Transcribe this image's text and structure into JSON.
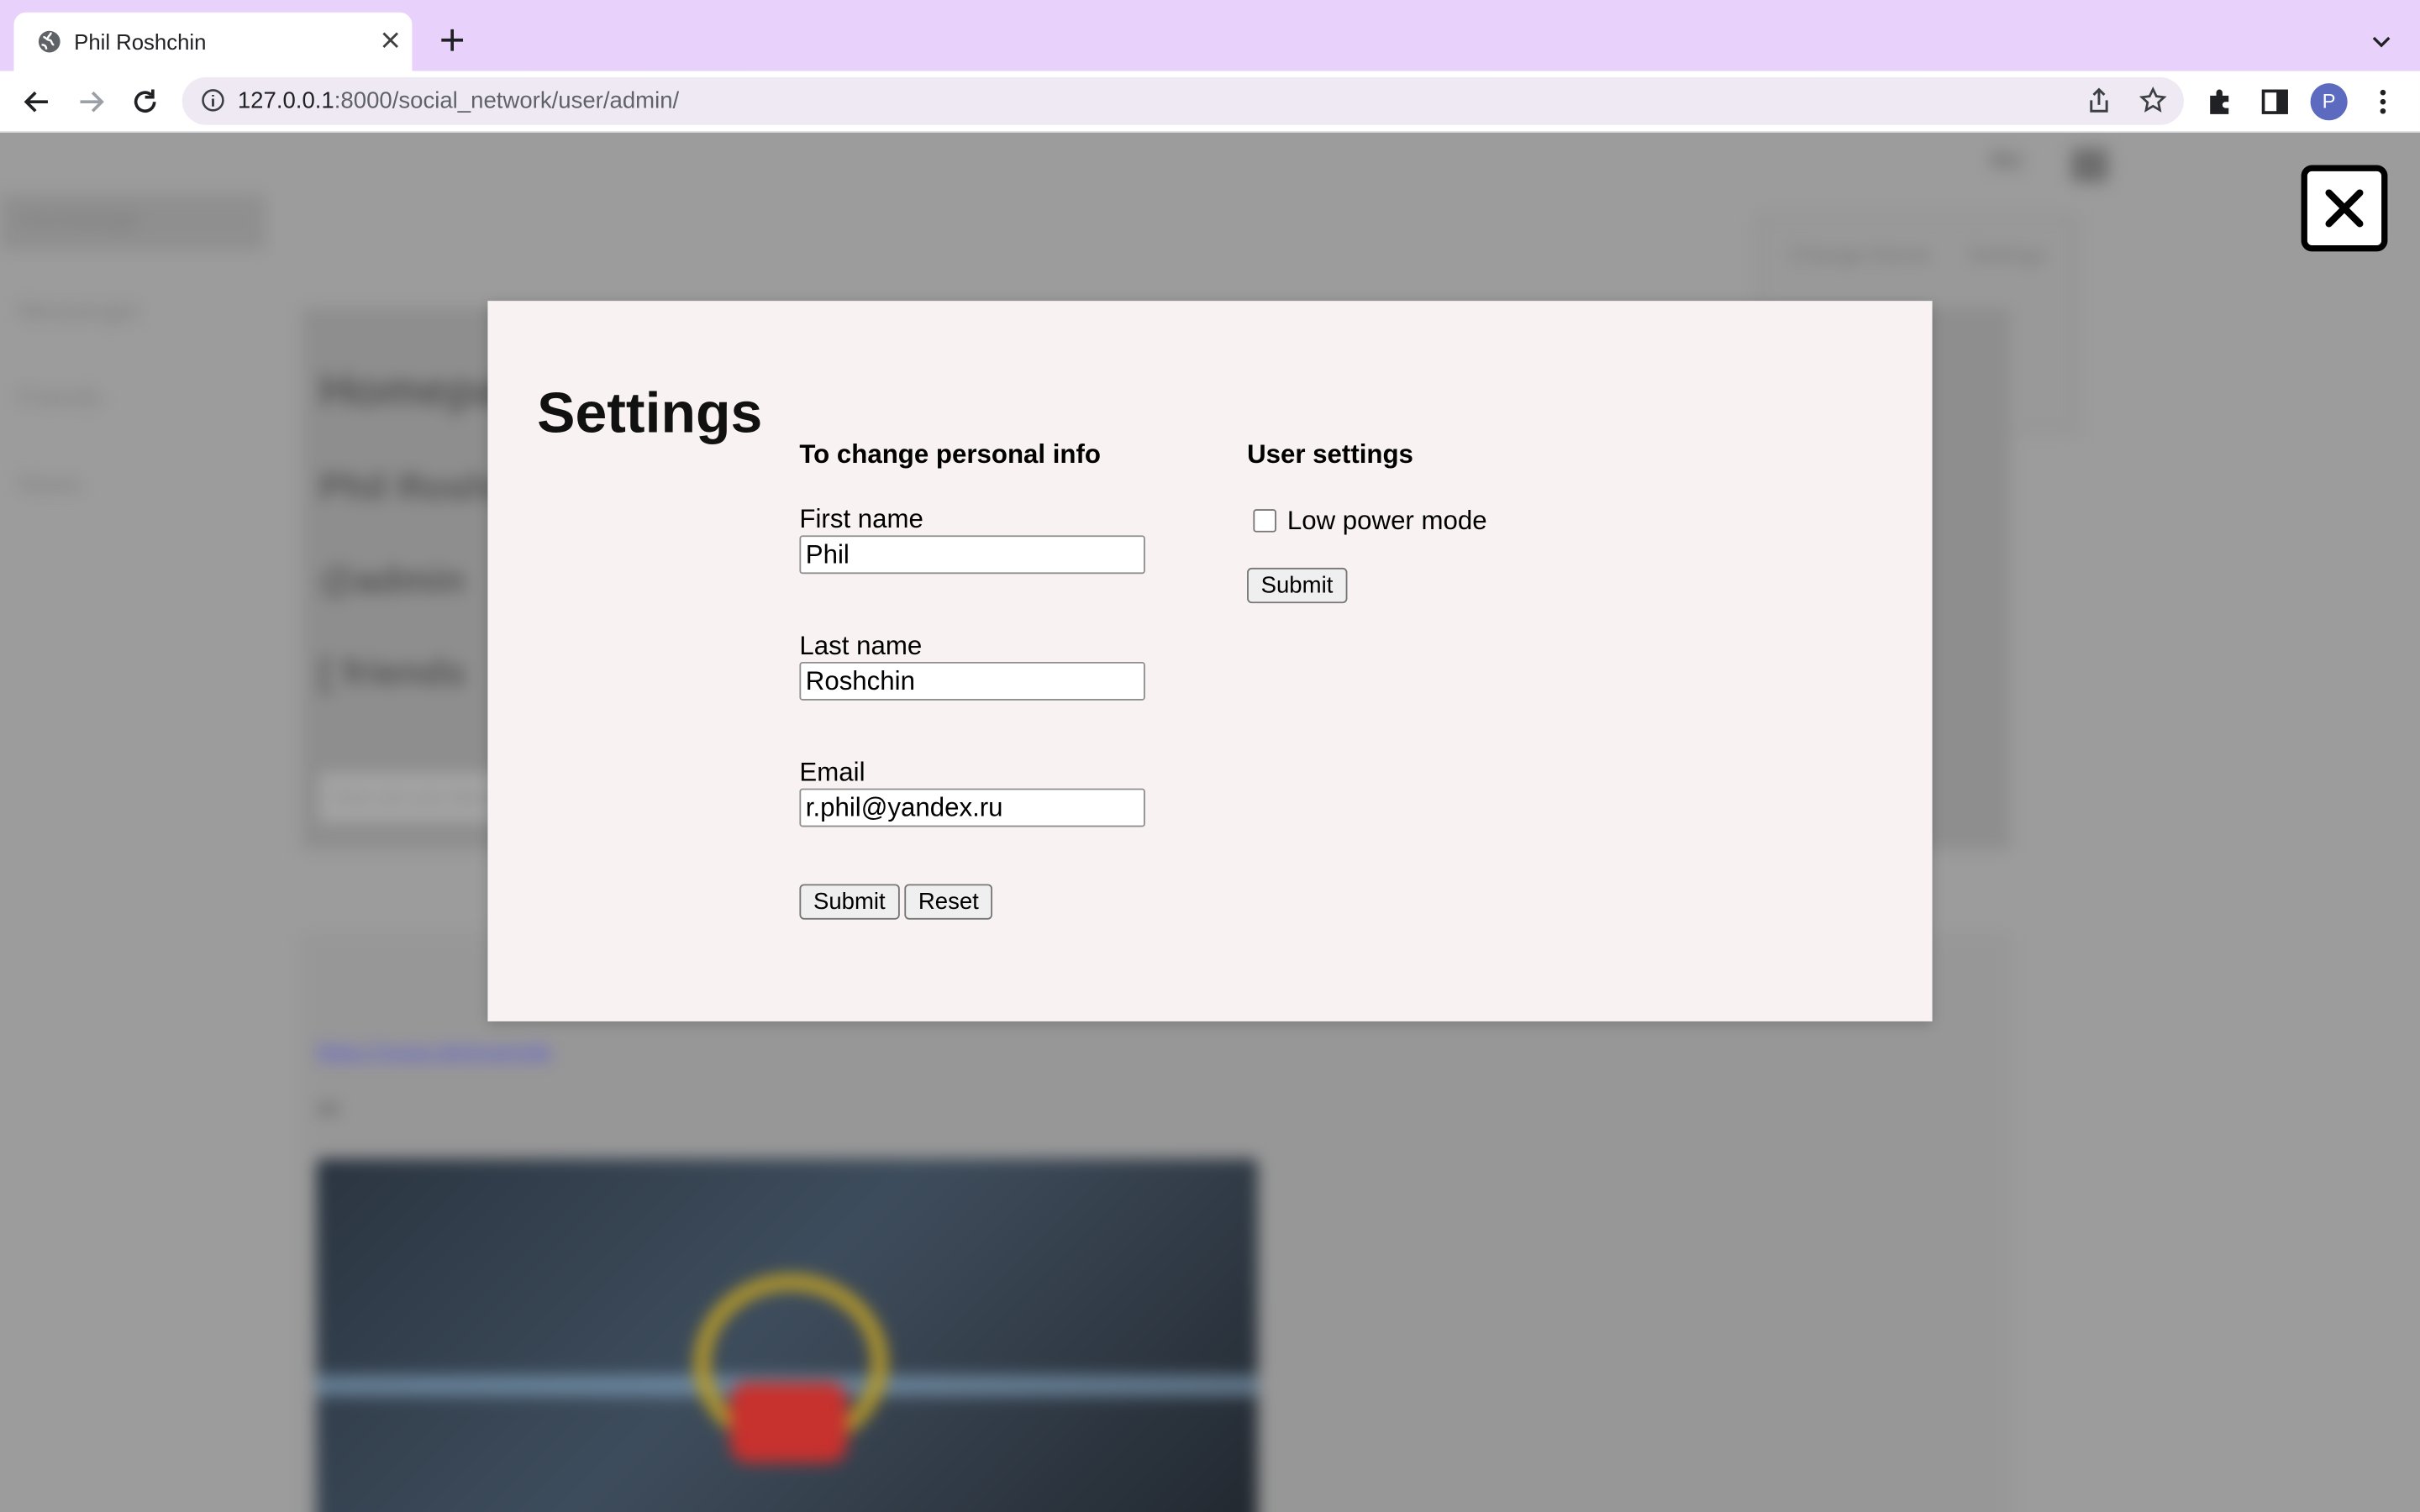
{
  "browser": {
    "tab_title": "Phil Roshchin",
    "url_host": "127.0.0.1",
    "url_path": ":8000/social_network/user/admin/",
    "profile_initial": "P"
  },
  "background": {
    "sidebar_items": [
      "Homepage",
      "Messenger",
      "Friends",
      "News"
    ],
    "header_right": "RU",
    "card_lines": [
      "Homepage",
      "Phil Roshchin",
      "@admin",
      "[ friends"
    ],
    "menu_labels": [
      "Change theme",
      "Settings"
    ],
    "input_placeholder": "How are you doing?",
    "post_link": "https://youtu.be/example",
    "post_meta": "4d"
  },
  "modal": {
    "title": "Settings",
    "personal": {
      "heading": "To change personal info",
      "first_name_label": "First name",
      "first_name_value": "Phil",
      "last_name_label": "Last name",
      "last_name_value": "Roshchin",
      "email_label": "Email",
      "email_value": "r.phil@yandex.ru",
      "submit_label": "Submit",
      "reset_label": "Reset"
    },
    "user_settings": {
      "heading": "User settings",
      "low_power_label": "Low power mode",
      "low_power_checked": false,
      "submit_label": "Submit"
    }
  }
}
